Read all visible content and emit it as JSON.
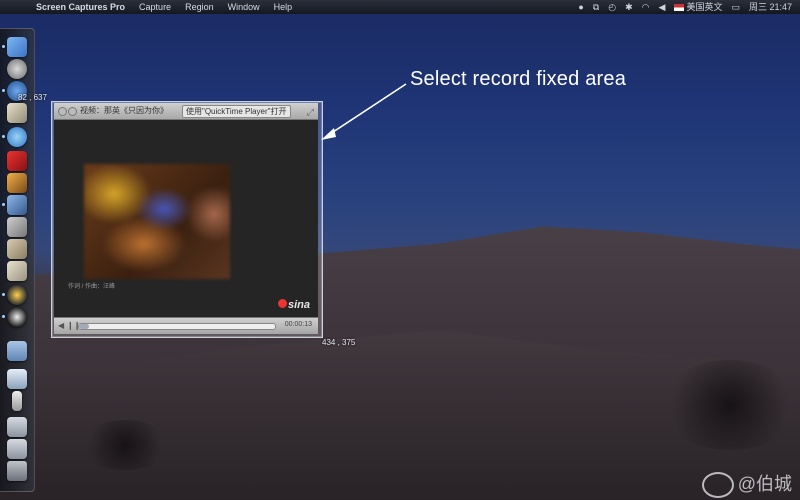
{
  "menubar": {
    "app_name": "Screen Captures Pro",
    "menus": [
      "Capture",
      "Region",
      "Window",
      "Help"
    ],
    "input_method": "美国英文",
    "datetime": "周三 21:47"
  },
  "selection": {
    "start_coord": "82 , 637",
    "end_coord": "434 , 375"
  },
  "player": {
    "title": "视频：那英《只因为你》",
    "open_button": "使用\"QuickTime Player\"打开",
    "subtitle": "作词 / 作曲：汪峰",
    "logo": "sina",
    "time": "00:00:13",
    "progress": 0.05
  },
  "annotation": {
    "text": "Select  record  fixed area"
  },
  "watermark": {
    "text": "@伯城"
  },
  "dock": {
    "items": [
      "finder-icon",
      "rocket-icon",
      "clock-icon",
      "preview-icon",
      "safari-icon",
      "books-icon",
      "photo-icon",
      "pencil-icon",
      "script-icon",
      "stack-icon",
      "files-icon",
      "qq-icon",
      "penguin-icon",
      "folder-icon",
      "window-icon",
      "doc-icon",
      "screen-icon",
      "screen2-icon",
      "trash-icon"
    ]
  }
}
